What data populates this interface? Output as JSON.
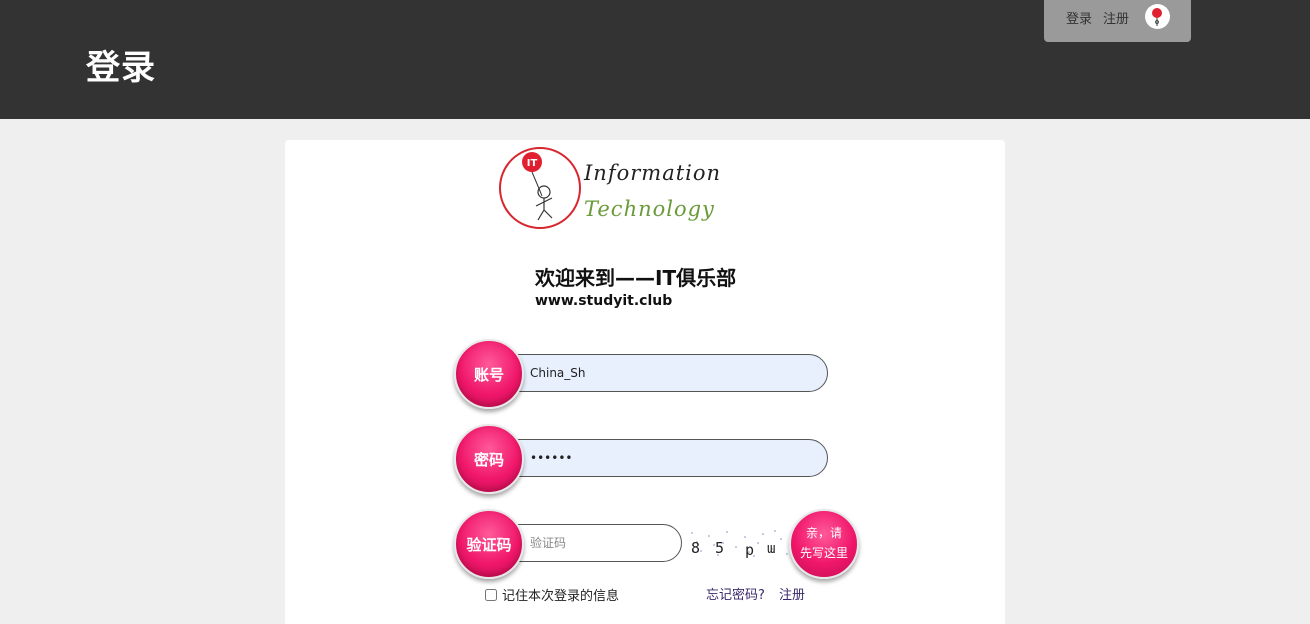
{
  "header": {
    "title": "登录",
    "menu": {
      "login": "登录",
      "register": "注册"
    }
  },
  "logo": {
    "badge_text": "IT",
    "line1": "Information",
    "line2": "Technology"
  },
  "welcome": {
    "title": "欢迎来到——IT俱乐部",
    "site": "www.studyit.club"
  },
  "form": {
    "account_label": "账号",
    "account_value": "China_Sh",
    "password_label": "密码",
    "password_value": "••••••",
    "code_label": "验证码",
    "code_placeholder": "验证码",
    "captcha_chars": [
      "8",
      "5",
      "p",
      "ɯ"
    ],
    "submit_line1": "亲，请",
    "submit_line2": "先写这里",
    "remember_label": "记住本次登录的信息",
    "forgot_link": "忘记密码?",
    "register_link": "注册"
  },
  "colors": {
    "header_bg": "#333333",
    "accent": "#f0176a",
    "input_bg": "#e8f0fe",
    "link": "#3b2a6b"
  }
}
